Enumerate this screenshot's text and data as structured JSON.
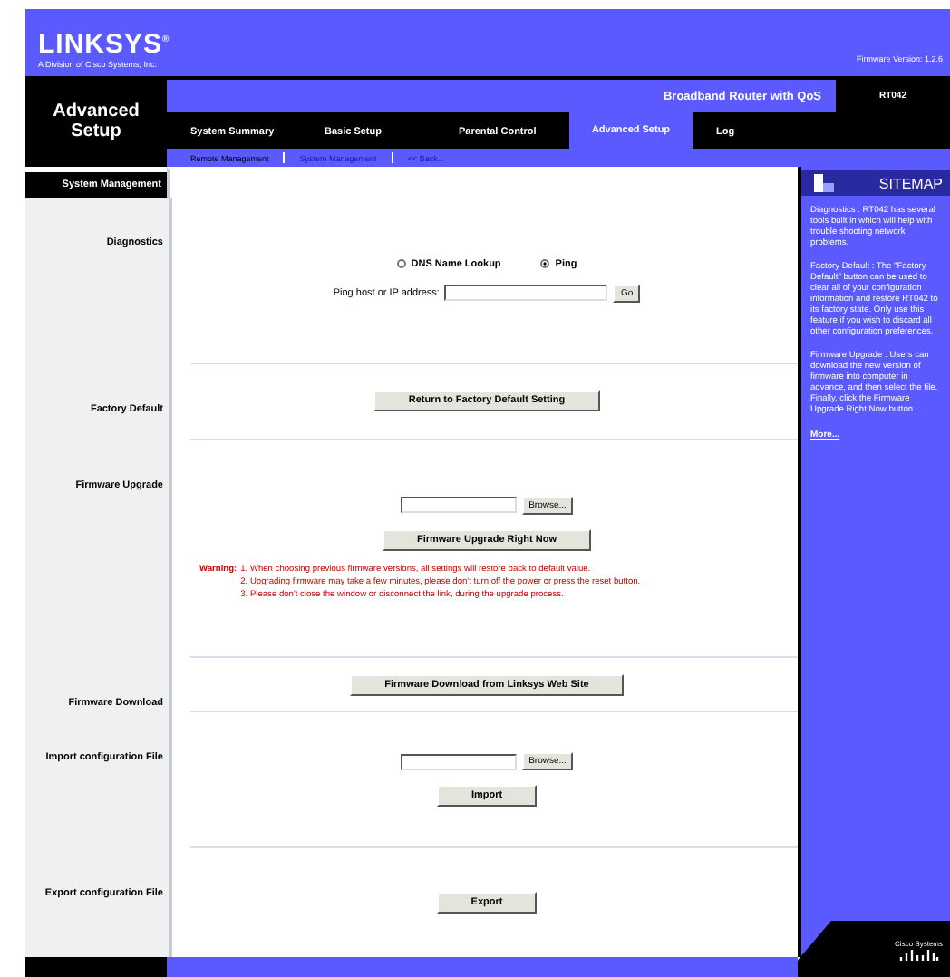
{
  "brand": {
    "logo": "LINKSYS",
    "registered": "®",
    "tagline": "A Division of Cisco Systems, Inc.",
    "firmware_version": "Firmware Version: 1.2.6"
  },
  "page_title": "Advanced Setup",
  "product": {
    "name": "Broadband Router with QoS",
    "model": "RT042"
  },
  "tabs": [
    {
      "label": "System Summary",
      "selected": false
    },
    {
      "label": "Basic Setup",
      "selected": false
    },
    {
      "label": "Parental Control",
      "selected": false
    },
    {
      "label": "Advanced Setup",
      "selected": true
    },
    {
      "label": "Log",
      "selected": false
    }
  ],
  "subtabs": [
    {
      "label": "Remote Management",
      "selected": true
    },
    {
      "label": "System Management",
      "selected": false
    },
    {
      "label": "<<  Back...",
      "selected": false
    }
  ],
  "section_header": "System Management",
  "sections": [
    {
      "label": "Diagnostics",
      "items": [
        {
          "kind": "radios",
          "options": [
            {
              "label": "DNS Name Lookup",
              "selected": false
            },
            {
              "label": "Ping",
              "selected": true
            }
          ]
        },
        {
          "kind": "field",
          "label": "Ping host or IP address:",
          "button": "Go"
        }
      ]
    },
    {
      "label": "Factory Default",
      "items": [
        {
          "kind": "button",
          "label": "Return to Factory Default Setting"
        }
      ]
    },
    {
      "label": "Firmware Upgrade",
      "items": [
        {
          "kind": "file",
          "button": "Browse..."
        },
        {
          "kind": "button",
          "label": "Firmware Upgrade Right Now"
        },
        {
          "kind": "warning",
          "title": "Warning:",
          "lines": [
            "1. When choosing previous firmware versions, all settings will restore back to default value.",
            "2. Upgrading firmware may take a few minutes, please don't turn off the power or press the reset button.",
            "3. Please don't close the window or disconnect the link, during the upgrade process."
          ]
        }
      ]
    },
    {
      "label": "Firmware Download",
      "items": [
        {
          "kind": "button",
          "label": "Firmware Download from Linksys Web Site"
        }
      ]
    },
    {
      "label": "Import configuration File",
      "items": [
        {
          "kind": "file",
          "button": "Browse..."
        },
        {
          "kind": "button",
          "label": "Import"
        }
      ]
    },
    {
      "label": "Export configuration File",
      "items": [
        {
          "kind": "button",
          "label": "Export"
        }
      ]
    }
  ],
  "sitemap": {
    "title": "SITEMAP",
    "paragraphs": [
      "Diagnostics : RT042 has several tools built in which will help with trouble shooting network problems.",
      "Factory Default : The \"Factory Default\" button can be used to clear all of your configuration information and restore RT042 to its factory state. Only use this feature if you wish to discard all other configuration preferences.",
      "Firmware Upgrade : Users can download the new version of firmware into computer in advance, and then select the file. Finally, click the Firmware Upgrade Right Now button."
    ],
    "more": "More..."
  },
  "footer": {
    "logo": "Cisco Systems"
  }
}
